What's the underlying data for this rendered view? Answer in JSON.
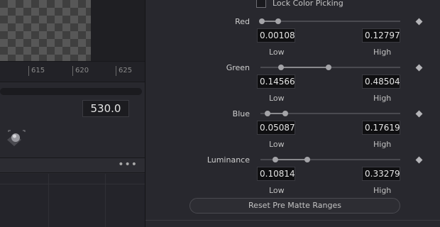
{
  "left": {
    "ruler_ticks": [
      "615",
      "620",
      "625"
    ],
    "frame_value": "530.0",
    "toolbar_more": "•••"
  },
  "panel": {
    "lock_label": "Lock Color Picking",
    "channels": [
      {
        "label": "Red",
        "low": "0.001084",
        "high": "0.127972",
        "low_label": "Low",
        "high_label": "High",
        "low_frac": 0.01,
        "high_frac": 0.128
      },
      {
        "label": "Green",
        "low": "0.145664",
        "high": "0.485041",
        "low_label": "Low",
        "high_label": "High",
        "low_frac": 0.146,
        "high_frac": 0.485
      },
      {
        "label": "Blue",
        "low": "0.050873",
        "high": "0.176199",
        "low_label": "Low",
        "high_label": "High",
        "low_frac": 0.051,
        "high_frac": 0.176
      },
      {
        "label": "Luminance",
        "low": "0.108147",
        "high": "0.332799",
        "low_label": "Low",
        "high_label": "High",
        "low_frac": 0.108,
        "high_frac": 0.333
      }
    ],
    "reset_label": "Reset Pre Matte Ranges"
  },
  "icons": {
    "keyframe": "diamond-keyframe-icon",
    "knob": "sphere-knob-icon",
    "more": "more-dots-icon"
  },
  "colors": {
    "background": "#28282e",
    "field_bg": "#0f0f11",
    "handle": "#a4a4a8"
  }
}
